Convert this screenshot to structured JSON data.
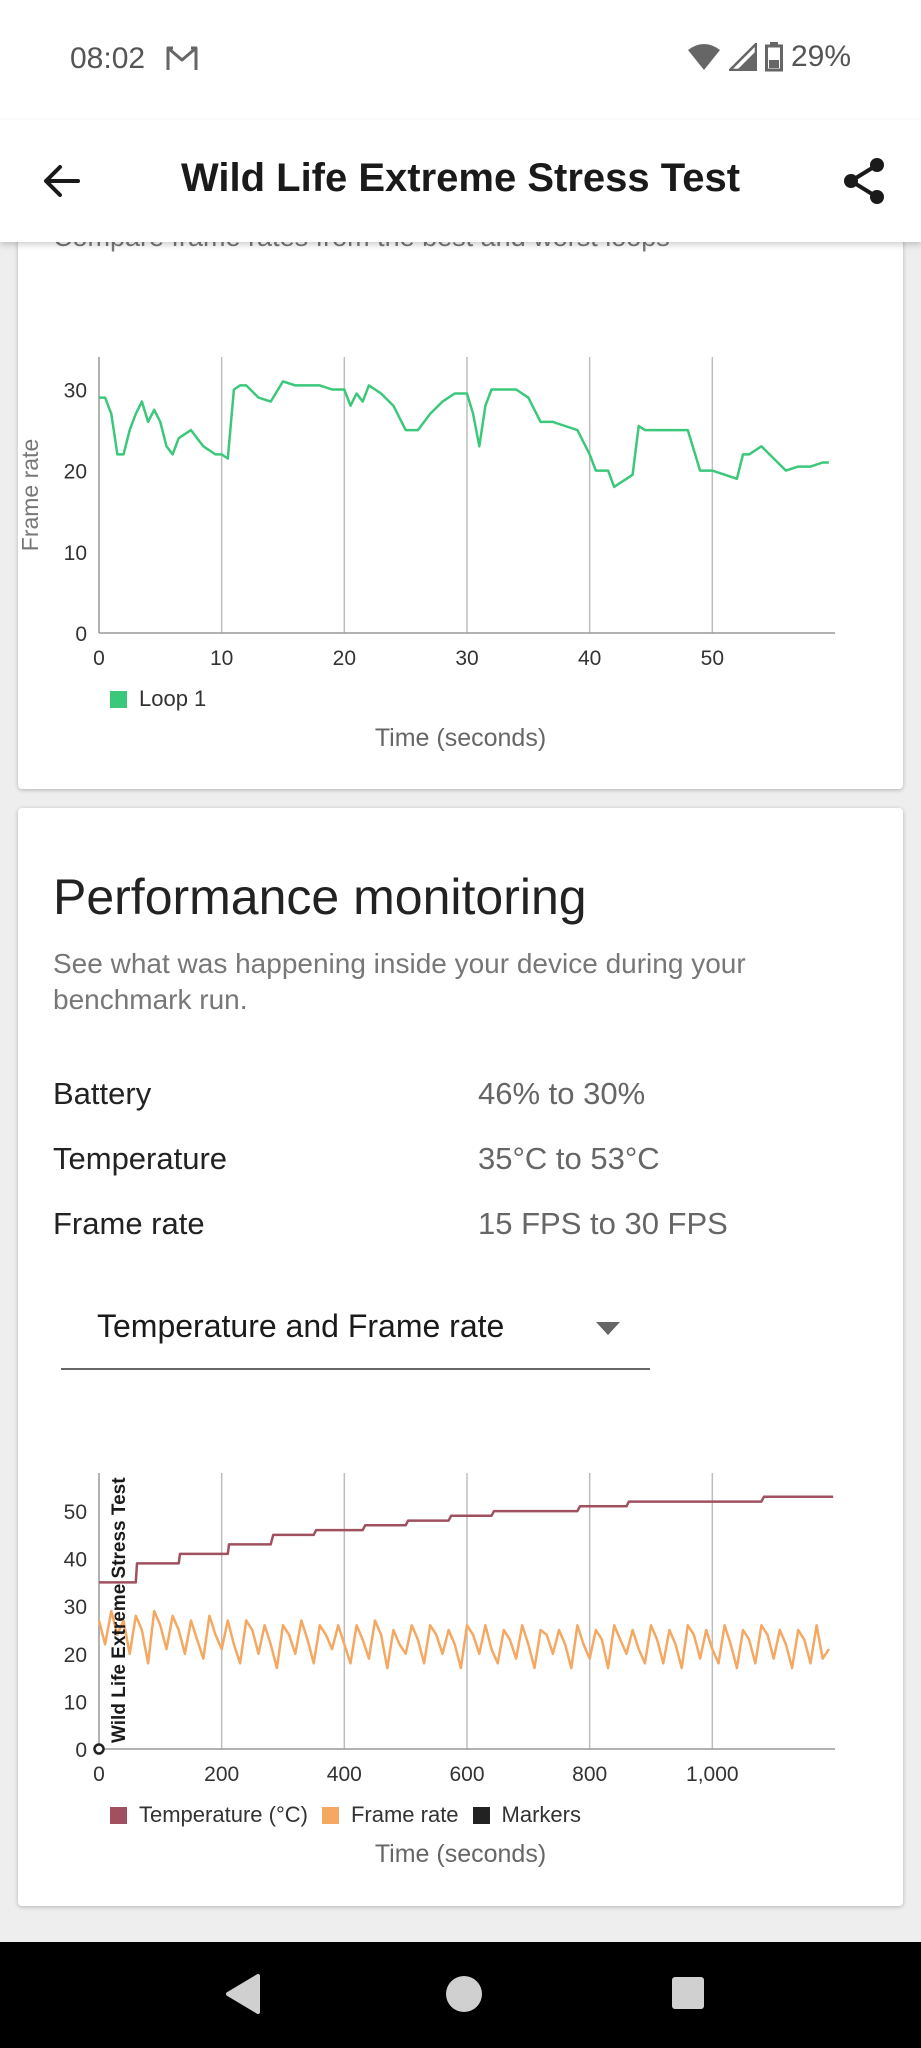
{
  "status_bar": {
    "time": "08:02",
    "battery": "29%",
    "mail_icon": "gmail-icon"
  },
  "app_bar": {
    "title": "Wild Life Extreme Stress Test",
    "back_icon": "arrow-left-icon",
    "share_icon": "share-icon"
  },
  "loop_card": {
    "subtitle": "Compare frame rates from the best and worst loops"
  },
  "performance": {
    "title": "Performance monitoring",
    "description": "See what was happening inside your device during your benchmark run.",
    "stats": [
      {
        "label": "Battery",
        "value": "46% to 30%"
      },
      {
        "label": "Temperature",
        "value": "35°C to 53°C"
      },
      {
        "label": "Frame rate",
        "value": "15 FPS to 30 FPS"
      }
    ],
    "dropdown": {
      "selected": "Temperature and Frame rate"
    }
  },
  "chart_data": [
    {
      "type": "line",
      "ylabel": "Frame rate",
      "xlabel": "Time (seconds)",
      "xlim": [
        0,
        60
      ],
      "ylim": [
        0,
        34
      ],
      "xticks": [
        0,
        10,
        20,
        30,
        40,
        50
      ],
      "xtick_labels": [
        "0",
        "10",
        "20",
        "30",
        "40",
        "50"
      ],
      "yticks": [
        0,
        10,
        20,
        30
      ],
      "ytick_labels": [
        "0",
        "10",
        "20",
        "30"
      ],
      "grid": "vertical",
      "legend_position": "bottom-left",
      "series": [
        {
          "name": "Loop 1",
          "color": "#3cc87a",
          "x": [
            0,
            0.5,
            1,
            1.5,
            2,
            2.5,
            3,
            3.5,
            4,
            4.5,
            5,
            5.5,
            6,
            6.5,
            7,
            7.5,
            8,
            8.5,
            9,
            9.5,
            10,
            10.5,
            11,
            11.5,
            12,
            13,
            14,
            15,
            16,
            17,
            18,
            19,
            20,
            20.5,
            21,
            21.5,
            22,
            23,
            24,
            25,
            26,
            27,
            28,
            29,
            30,
            30.5,
            31,
            31.5,
            32,
            33,
            34,
            35,
            36,
            37,
            38,
            39,
            40,
            40.5,
            41,
            41.5,
            42,
            42.5,
            43,
            43.5,
            44,
            44.5,
            45,
            46,
            47,
            48,
            49,
            50,
            51,
            52,
            52.5,
            53,
            54,
            55,
            56,
            57,
            58,
            59,
            59.5
          ],
          "y": [
            29,
            29,
            27,
            22,
            22,
            25,
            27,
            28.5,
            26,
            27.5,
            26,
            23,
            22,
            24,
            24.5,
            25,
            24,
            23,
            22.5,
            22,
            22,
            21.5,
            30,
            30.5,
            30.5,
            29,
            28.5,
            31,
            30.5,
            30.5,
            30.5,
            30,
            30,
            28,
            29.5,
            28.5,
            30.5,
            29.5,
            28,
            25,
            25,
            27,
            28.5,
            29.5,
            29.5,
            27,
            23,
            28,
            30,
            30,
            30,
            29,
            26,
            26,
            25.5,
            25,
            22,
            20,
            20,
            20,
            18,
            18.5,
            19,
            19.5,
            25.5,
            25,
            25,
            25,
            25,
            25,
            20,
            20,
            19.5,
            19,
            22,
            22,
            23,
            21.5,
            20,
            20.5,
            20.5,
            21,
            21
          ]
        }
      ]
    },
    {
      "type": "line",
      "xlabel": "Time (seconds)",
      "annotation": "Wild Life Extreme Stress Test",
      "xlim": [
        0,
        1200
      ],
      "ylim": [
        0,
        58
      ],
      "xticks": [
        0,
        200,
        400,
        600,
        800,
        1000
      ],
      "xtick_labels": [
        "0",
        "200",
        "400",
        "600",
        "800",
        "1,000"
      ],
      "yticks": [
        0,
        10,
        20,
        30,
        40,
        50
      ],
      "ytick_labels": [
        "0",
        "10",
        "20",
        "30",
        "40",
        "50"
      ],
      "grid": "vertical",
      "legend_position": "bottom-left",
      "series": [
        {
          "name": "Temperature (°C)",
          "color": "#a0505e",
          "x": [
            0,
            60,
            62,
            130,
            132,
            210,
            212,
            280,
            284,
            350,
            354,
            430,
            434,
            500,
            504,
            570,
            574,
            640,
            644,
            780,
            784,
            860,
            864,
            1080,
            1084,
            1197
          ],
          "y": [
            35,
            35,
            39,
            39,
            41,
            41,
            43,
            43,
            45,
            45,
            46,
            46,
            47,
            47,
            48,
            48,
            49,
            49,
            50,
            50,
            51,
            51,
            52,
            52,
            53,
            53
          ]
        },
        {
          "name": "Frame rate",
          "color": "#f5a862",
          "x": [
            0,
            10,
            20,
            30,
            40,
            50,
            60,
            70,
            80,
            90,
            100,
            110,
            120,
            130,
            140,
            150,
            160,
            170,
            180,
            190,
            200,
            210,
            220,
            230,
            240,
            250,
            260,
            270,
            280,
            290,
            300,
            310,
            320,
            330,
            340,
            350,
            360,
            370,
            380,
            390,
            400,
            410,
            420,
            430,
            440,
            450,
            460,
            470,
            480,
            490,
            500,
            510,
            520,
            530,
            540,
            550,
            560,
            570,
            580,
            590,
            600,
            610,
            620,
            630,
            640,
            650,
            660,
            670,
            680,
            690,
            700,
            710,
            720,
            730,
            740,
            750,
            760,
            770,
            780,
            790,
            800,
            810,
            820,
            830,
            840,
            850,
            860,
            870,
            880,
            890,
            900,
            910,
            920,
            930,
            940,
            950,
            960,
            970,
            980,
            990,
            1000,
            1010,
            1020,
            1030,
            1040,
            1050,
            1060,
            1070,
            1080,
            1090,
            1100,
            1110,
            1120,
            1130,
            1140,
            1150,
            1160,
            1170,
            1180,
            1190
          ],
          "y": [
            27,
            22,
            29,
            24,
            27,
            20,
            28,
            25,
            18,
            29,
            26,
            21,
            28,
            25,
            20,
            27,
            23,
            19,
            28,
            24,
            21,
            27,
            22,
            18,
            27,
            25,
            20,
            26,
            22,
            17,
            26,
            24,
            20,
            27,
            23,
            18,
            26,
            24,
            21,
            26,
            22,
            18,
            26,
            23,
            19,
            27,
            24,
            17,
            25,
            22,
            20,
            26,
            23,
            18,
            26,
            24,
            20,
            25,
            22,
            17,
            26,
            24,
            20,
            26,
            21,
            18,
            25,
            23,
            19,
            26,
            22,
            17,
            25,
            24,
            20,
            25,
            22,
            17,
            26,
            22,
            19,
            25,
            23,
            17,
            26,
            23,
            20,
            25,
            21,
            18,
            26,
            23,
            18,
            25,
            22,
            17,
            26,
            24,
            19,
            25,
            21,
            18,
            26,
            22,
            17,
            25,
            23,
            18,
            26,
            24,
            19,
            25,
            22,
            17,
            25,
            23,
            18,
            26,
            19,
            21
          ]
        },
        {
          "name": "Markers",
          "color": "#222222",
          "x": [
            0
          ],
          "y": [
            0
          ]
        }
      ]
    }
  ]
}
